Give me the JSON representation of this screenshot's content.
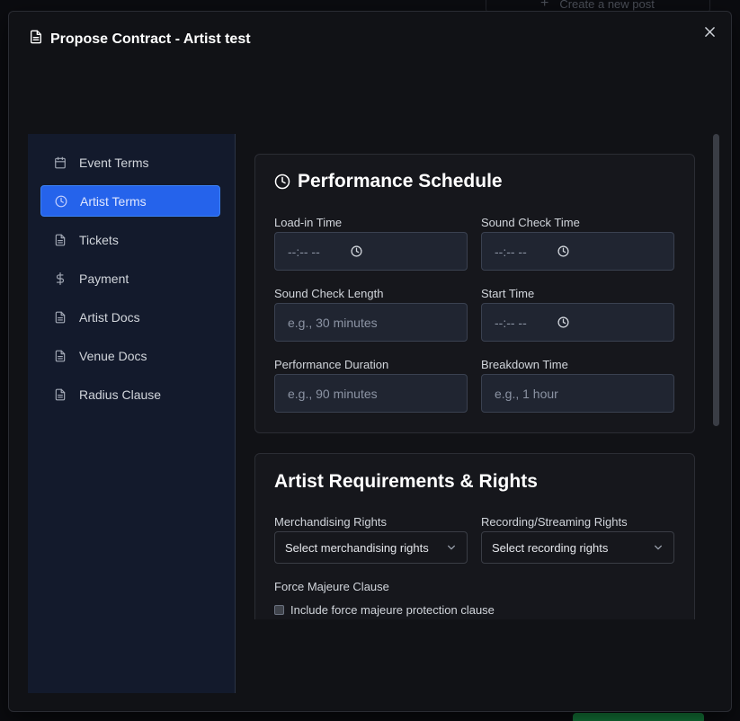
{
  "background": {
    "create_post_label": "Create a new post"
  },
  "modal": {
    "title": "Propose Contract - Artist test",
    "close_glyph": "×"
  },
  "sidebar": {
    "items": [
      {
        "label": "Event Terms",
        "icon": "calendar-icon",
        "active": false
      },
      {
        "label": "Artist Terms",
        "icon": "clock-icon",
        "active": true
      },
      {
        "label": "Tickets",
        "icon": "document-icon",
        "active": false
      },
      {
        "label": "Payment",
        "icon": "dollar-icon",
        "active": false
      },
      {
        "label": "Artist Docs",
        "icon": "document-icon",
        "active": false
      },
      {
        "label": "Venue Docs",
        "icon": "document-icon",
        "active": false
      },
      {
        "label": "Radius Clause",
        "icon": "document-icon",
        "active": false
      }
    ]
  },
  "performance_schedule": {
    "title": "Performance Schedule",
    "load_in_time": {
      "label": "Load-in Time",
      "value": "--:-- --"
    },
    "sound_check_time": {
      "label": "Sound Check Time",
      "value": "--:-- --"
    },
    "sound_check_length": {
      "label": "Sound Check Length",
      "placeholder": "e.g., 30 minutes"
    },
    "start_time": {
      "label": "Start Time",
      "value": "--:-- --"
    },
    "performance_duration": {
      "label": "Performance Duration",
      "placeholder": "e.g., 90 minutes"
    },
    "breakdown_time": {
      "label": "Breakdown Time",
      "placeholder": "e.g., 1 hour"
    }
  },
  "artist_requirements": {
    "title": "Artist Requirements & Rights",
    "merchandising": {
      "label": "Merchandising Rights",
      "selected": "Select merchandising rights"
    },
    "recording": {
      "label": "Recording/Streaming Rights",
      "selected": "Select recording rights"
    },
    "force_majeure": {
      "label": "Force Majeure Clause",
      "checkbox_label": "Include force majeure protection clause",
      "checked": false
    }
  },
  "colors": {
    "accent": "#2563eb",
    "sidebar_bg": "#131a2c",
    "card_bg": "#16171c"
  }
}
